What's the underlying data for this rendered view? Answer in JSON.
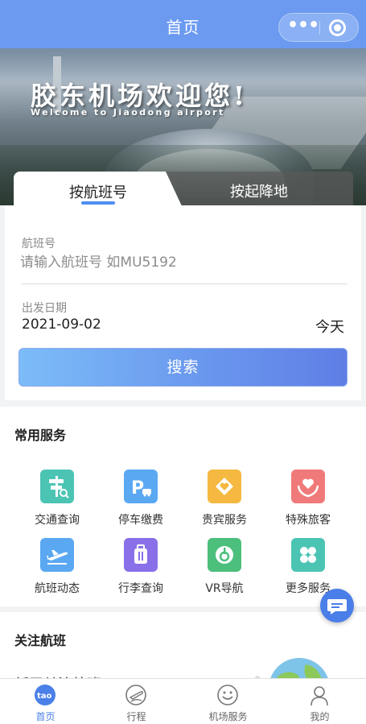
{
  "navbar": {
    "title": "首页",
    "more_icon": "ellipsis-icon",
    "close_icon": "target-icon"
  },
  "banner": {
    "title": "胶东机场欢迎您!",
    "subtitle": "Welcome to Jiaodong airport"
  },
  "search_tabs": {
    "active": "按航班号",
    "inactive": "按起降地"
  },
  "search_form": {
    "flight_label": "航班号",
    "flight_placeholder": "请输入航班号 如MU5192",
    "date_label": "出发日期",
    "date_value": "2021-09-02",
    "date_relative": "今天",
    "search_button": "搜索"
  },
  "services": {
    "title": "常用服务",
    "items": [
      {
        "label": "交通查询",
        "icon": "traffic-sign-icon",
        "color": "#4cc4b4"
      },
      {
        "label": "停车缴费",
        "icon": "parking-icon",
        "color": "#5aa8f2"
      },
      {
        "label": "贵宾服务",
        "icon": "diamond-heart-icon",
        "color": "#f5b840"
      },
      {
        "label": "特殊旅客",
        "icon": "care-heart-icon",
        "color": "#f07a7a"
      },
      {
        "label": "航班动态",
        "icon": "airplane-icon",
        "color": "#5aa8f2"
      },
      {
        "label": "行李查询",
        "icon": "luggage-icon",
        "color": "#8a70e8"
      },
      {
        "label": "VR导航",
        "icon": "vr-navigation-icon",
        "color": "#4cbf7c"
      },
      {
        "label": "更多服务",
        "icon": "clover-icon",
        "color": "#4cc4b4"
      }
    ]
  },
  "watch": {
    "title": "关注航班",
    "empty_text": "暂无关注航班"
  },
  "tabbar": {
    "items": [
      {
        "label": "首页",
        "icon": "home-icon",
        "active": true
      },
      {
        "label": "行程",
        "icon": "trip-icon",
        "active": false
      },
      {
        "label": "机场服务",
        "icon": "smile-icon",
        "active": false
      },
      {
        "label": "我的",
        "icon": "user-icon",
        "active": false
      }
    ]
  },
  "colors": {
    "primary": "#6b9af0",
    "accent_blue": "#4a80e8"
  }
}
